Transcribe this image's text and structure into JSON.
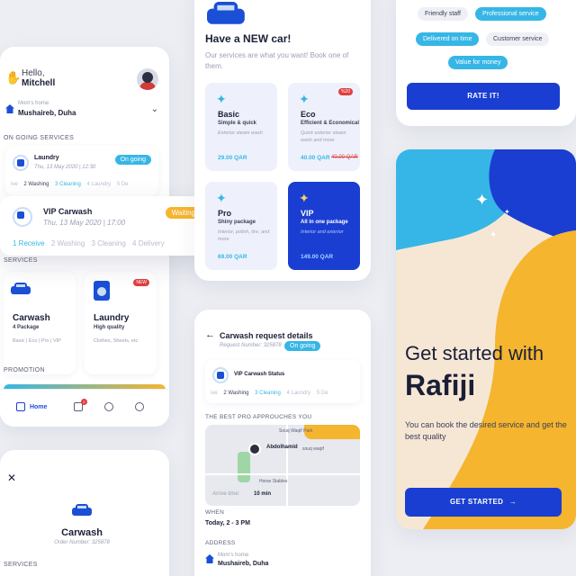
{
  "home": {
    "greeting": "Hello,",
    "user_name": "Mitchell",
    "address_label": "Mom's home",
    "address_value": "Mushaireb, Duha",
    "ongoing_header": "ON GOING SERVICES",
    "ongoing": [
      {
        "title": "Laundry",
        "date": "Thu, 13 May 2020 | 12:30",
        "status": "On going",
        "steps": [
          "ive",
          "2 Washing",
          "3 Cleaning",
          "4 Laundry",
          "5 De"
        ]
      }
    ],
    "vip_ongoing": {
      "title": "VIP Carwash",
      "date": "Thu, 13 May 2020 | 17:00",
      "status": "Waiting",
      "steps": [
        "1 Receive",
        "2 Washing",
        "3 Cleaning",
        "4 Delivery"
      ]
    },
    "services_header": "SERVICES",
    "services": [
      {
        "title": "Carwash",
        "subtitle": "4 Package",
        "detail": "Basic | Eco | Pro | VIP"
      },
      {
        "title": "Laundry",
        "subtitle": "High quality",
        "detail": "Clothes, Sheets, etc",
        "badge": "NEW"
      }
    ],
    "promotion_header": "PROMOTION",
    "nav": {
      "home": "Home",
      "badge_count": "2"
    }
  },
  "carwash_card": {
    "title": "Carwash",
    "order_number": "Order Number: 325878",
    "services_header": "SERVICES"
  },
  "new_car": {
    "title": "Have a NEW car!",
    "subtitle": "Our services are what you want! Book one of them.",
    "packages": [
      {
        "name": "Basic",
        "tagline": "Simple & quick",
        "desc": "Exterior steam wash",
        "price": "29.00 QAR"
      },
      {
        "name": "Eco",
        "tagline": "Efficient & Economical",
        "desc": "Quick exterior steam wash and more",
        "price": "40.00 QAR",
        "old_price": "40.00 QAR",
        "badge": "%20"
      },
      {
        "name": "Pro",
        "tagline": "Shiny package",
        "desc": "Interior, polish, tire, and more",
        "price": "69.00 QAR"
      },
      {
        "name": "VIP",
        "tagline": "All in one package",
        "desc": "Interior and exterior",
        "price": "149.00 QAR"
      }
    ]
  },
  "request": {
    "title": "Carwash request details",
    "request_number": "Request Number: 325878",
    "status": "On going",
    "service_name": "VIP Carwash Status",
    "steps": [
      "ive",
      "2 Washing",
      "3 Cleaning",
      "4 Laundry",
      "5 De"
    ],
    "pro_header": "THE BEST PRO APPROUCHES YOU",
    "map_labels": [
      "Souq Waqif Park",
      "Abdolhamid",
      "souq waqif",
      "Horse Stables"
    ],
    "arrive_label": "Arrive time:",
    "arrive_value": "10 min",
    "when_header": "WHEN",
    "when_value": "Today, 2 - 3 PM",
    "address_header": "ADDRESS",
    "address_label": "Mom's home",
    "address_value": "Mushaireb, Duha"
  },
  "rate": {
    "tags": [
      {
        "label": "Friendly staff",
        "selected": false
      },
      {
        "label": "Professional service",
        "selected": true
      },
      {
        "label": "Delivered on time",
        "selected": true
      },
      {
        "label": "Customer service",
        "selected": false
      },
      {
        "label": "Value for money",
        "selected": true
      }
    ],
    "button": "RATE IT!"
  },
  "onboarding": {
    "headline": "Get started with",
    "brand": "Rafiji",
    "description": "You can book the desired service and get the best quality",
    "button": "GET STARTED"
  },
  "colors": {
    "primary": "#1a3ed1",
    "accent": "#36b6e6",
    "warning": "#f5b52f",
    "danger": "#e23d3d"
  }
}
